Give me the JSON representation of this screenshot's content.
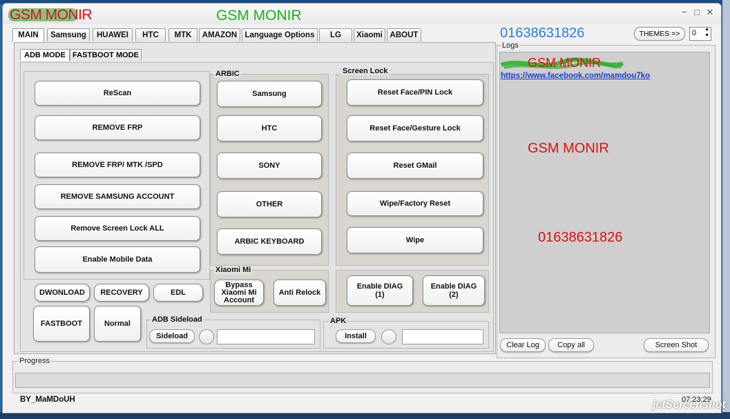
{
  "window": {
    "title_red": "GSM MONIR",
    "title_green": "GSM MONIR",
    "minimize_glyph": "−",
    "maximize_glyph": "□",
    "close_glyph": "✕"
  },
  "main_tabs": [
    "MAIN",
    "Samsung",
    "HUAWEI",
    "HTC",
    "MTK",
    "AMAZON",
    "Language Options",
    "LG",
    "Xiaomi",
    "ABOUT"
  ],
  "header": {
    "phone": "01638631826",
    "themes_label": "THEMES =>",
    "themes_value": "0"
  },
  "sub_tabs": [
    "ADB MODE",
    "FASTBOOT MODE"
  ],
  "left_buttons": [
    "ReScan",
    "REMOVE FRP",
    "REMOVE FRP/ MTK /SPD",
    "REMOVE SAMSUNG ACCOUNT",
    "Remove Screen Lock ALL",
    "Enable Mobile Data"
  ],
  "arbic": {
    "title": "ARBIC",
    "buttons": [
      "Samsung",
      "HTC",
      "SONY",
      "OTHER",
      "ARBIC KEYBOARD"
    ]
  },
  "screen_lock": {
    "title": "Screen Lock",
    "buttons": [
      "Reset Face/PIN Lock",
      "Reset Face/Gesture Lock",
      "Reset GMail",
      "Wipe/Factory Reset",
      "Wipe"
    ]
  },
  "mode_buttons": {
    "download": "DWONLOAD",
    "recovery": "RECOVERY",
    "edl": "EDL",
    "fastboot": "FASTBOOT",
    "normal": "Normal"
  },
  "xiaomi": {
    "title": "Xiaomi Mi",
    "bypass_line1": "Bypass",
    "bypass_line2": "Xiaomi Mi",
    "bypass_line3": "Account",
    "anti_relock": "Anti Relock"
  },
  "diag": {
    "diag1_line1": "Enable DIAG",
    "diag1_line2": "(1)",
    "diag2_line1": "Enable DIAG",
    "diag2_line2": "(2)"
  },
  "sideload": {
    "title": "ADB Sideload",
    "button": "Sideload",
    "value": ""
  },
  "apk": {
    "title": "APK",
    "button": "Install",
    "value": ""
  },
  "logs": {
    "label": "Logs",
    "line1": "GSM MONIR",
    "link": "https://www.facebook.com/mamdou7ko",
    "line2": "GSM MONIR",
    "line3": "01638631826",
    "clear": "Clear Log",
    "copy": "Copy all",
    "screenshot": "Screen Shot"
  },
  "progress": {
    "label": "Progress",
    "value": 0
  },
  "status": {
    "author": "BY_MaMDoUH",
    "time": "07:23:29"
  },
  "watermark": "jetScreenshot"
}
